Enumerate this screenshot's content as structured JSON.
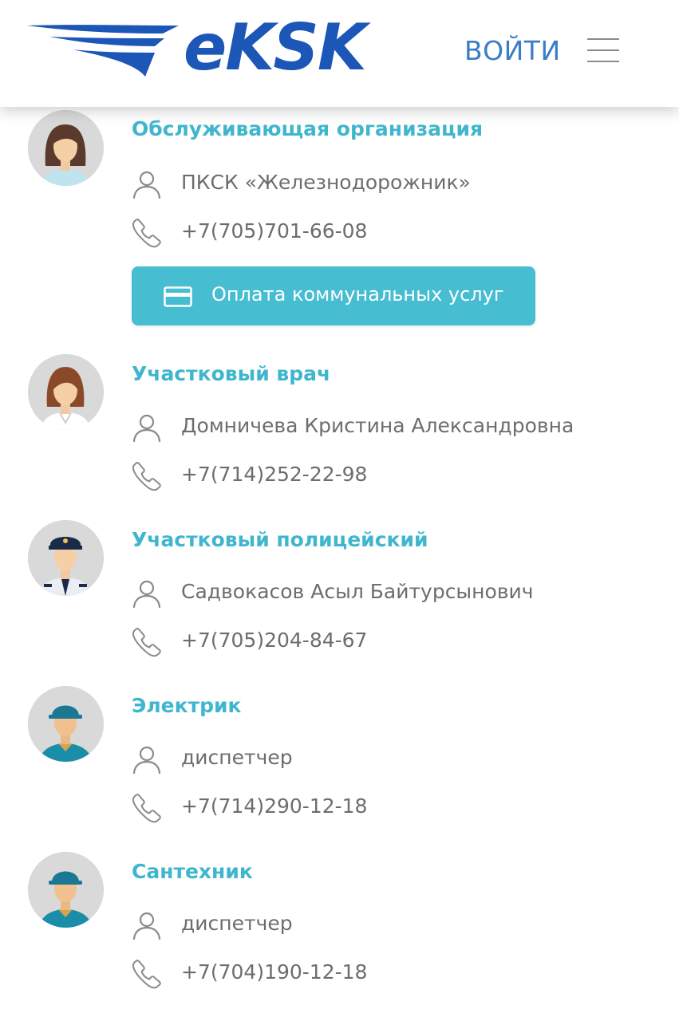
{
  "header": {
    "logo_text": "eKSK",
    "login_label": "ВОЙТИ"
  },
  "colors": {
    "accent": "#3fb6cd",
    "button": "#46bdd1",
    "logo": "#1c57b8",
    "login": "#3b7cc7",
    "text": "#6d6d6d"
  },
  "contacts": [
    {
      "title": "Обслуживающая организация",
      "avatar_icon": "woman-avatar-icon",
      "name": "ПКСК «Железнодорожник»",
      "phone": "+7(705)701-66-08",
      "button_label": "Оплата коммунальных услуг"
    },
    {
      "title": "Участковый врач",
      "avatar_icon": "doctor-avatar-icon",
      "name": "Домничева Кристина Александровна",
      "phone": "+7(714)252-22-98"
    },
    {
      "title": "Участковый полицейский",
      "avatar_icon": "police-avatar-icon",
      "name": "Садвокасов Асыл Байтурсынович",
      "phone": "+7(705)204-84-67"
    },
    {
      "title": "Электрик",
      "avatar_icon": "electrician-avatar-icon",
      "name": "диспетчер",
      "phone": "+7(714)290-12-18"
    },
    {
      "title": "Сантехник",
      "avatar_icon": "plumber-avatar-icon",
      "name": "диспетчер",
      "phone": "+7(704)190-12-18"
    }
  ]
}
